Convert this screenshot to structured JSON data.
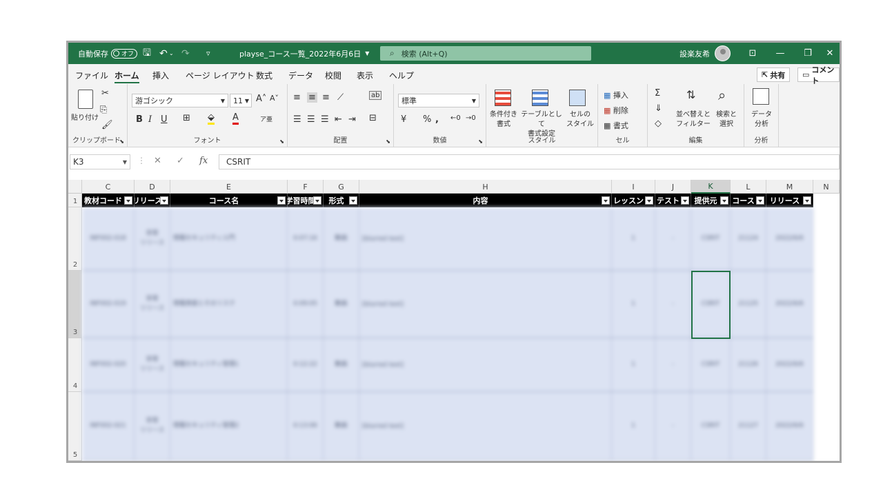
{
  "titlebar": {
    "autosave_label": "自動保存",
    "autosave_state": "オフ",
    "filename": "playse_コース一覧_2022年6月6日",
    "search_placeholder": "検索 (Alt+Q)",
    "user_name": "設楽友希"
  },
  "menu": {
    "items": [
      "ファイル",
      "ホーム",
      "挿入",
      "ページ レイアウト",
      "数式",
      "データ",
      "校閲",
      "表示",
      "ヘルプ"
    ],
    "active": "ホーム",
    "share_label": "共有",
    "comment_label": "コメント"
  },
  "ribbon": {
    "clipboard": {
      "label": "クリップボード",
      "paste_label": "貼り付け"
    },
    "font": {
      "label": "フォント",
      "font_name": "游ゴシック",
      "font_size": "11"
    },
    "alignment": {
      "label": "配置"
    },
    "number": {
      "label": "数値",
      "format": "標準"
    },
    "styles": {
      "label": "スタイル",
      "conditional": "条件付き\n書式",
      "table": "テーブルとして\n書式設定",
      "cell": "セルの\nスタイル"
    },
    "cells": {
      "label": "セル",
      "insert": "挿入",
      "delete": "削除",
      "format": "書式"
    },
    "editing": {
      "label": "編集",
      "sort": "並べ替えと\nフィルター",
      "find": "検索と\n選択"
    },
    "analysis": {
      "label": "分析",
      "data_analysis": "データ\n分析"
    }
  },
  "formula_bar": {
    "name_box": "K3",
    "value": "CSRIT"
  },
  "sheet": {
    "column_letters": [
      "C",
      "D",
      "E",
      "F",
      "G",
      "H",
      "I",
      "J",
      "K",
      "L",
      "M",
      "N"
    ],
    "selected_column": "K",
    "headers": [
      "教材コード",
      "リリース",
      "コース名",
      "学習時間",
      "形式",
      "内容",
      "レッスン",
      "テスト",
      "提供元",
      "コース",
      "リリース"
    ],
    "row_numbers": [
      "1",
      "2",
      "3",
      "4",
      "5"
    ],
    "rows": [
      {
        "code": "INF002-018",
        "release": "非常\nリリース",
        "course": "情報セキュリティ入門",
        "time": "0:07:16",
        "format": "動画",
        "content": "[blurred text]",
        "lessons": "1",
        "test": "-",
        "provider": "CSRIT",
        "course_id": "21124",
        "date": "2022/6/6"
      },
      {
        "code": "INF002-019",
        "release": "非常\nリリース",
        "course": "情報資産とそのリスク",
        "time": "0:09:05",
        "format": "動画",
        "content": "[blurred text]",
        "lessons": "1",
        "test": "-",
        "provider": "CSRIT",
        "course_id": "21125",
        "date": "2022/6/6"
      },
      {
        "code": "INF002-020",
        "release": "非常\nリリース",
        "course": "情報セキュリティ管理1",
        "time": "0:12:22",
        "format": "動画",
        "content": "[blurred text]",
        "lessons": "1",
        "test": "-",
        "provider": "CSRIT",
        "course_id": "21126",
        "date": "2022/6/6"
      },
      {
        "code": "INF002-021",
        "release": "非常\nリリース",
        "course": "情報セキュリティ管理2",
        "time": "0:13:06",
        "format": "動画",
        "content": "[blurred text]",
        "lessons": "1",
        "test": "-",
        "provider": "CSRIT",
        "course_id": "21127",
        "date": "2022/6/6"
      }
    ]
  }
}
